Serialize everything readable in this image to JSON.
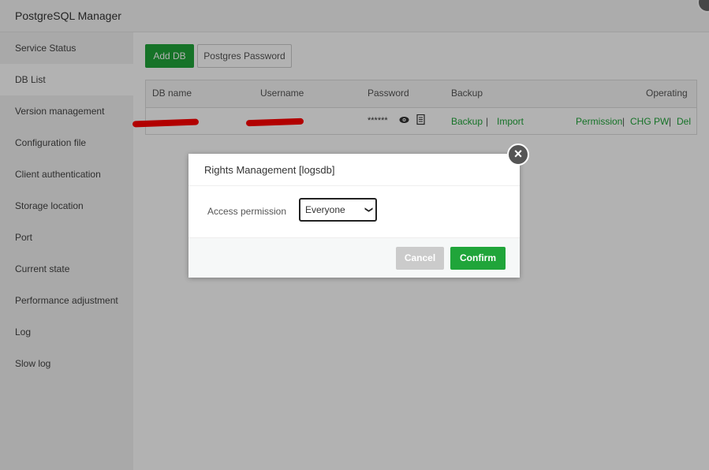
{
  "app": {
    "title": "PostgreSQL Manager"
  },
  "sidebar": {
    "items": [
      {
        "label": "Service Status"
      },
      {
        "label": "DB List"
      },
      {
        "label": "Version management"
      },
      {
        "label": "Configuration file"
      },
      {
        "label": "Client authentication"
      },
      {
        "label": "Storage location"
      },
      {
        "label": "Port"
      },
      {
        "label": "Current state"
      },
      {
        "label": "Performance adjustment"
      },
      {
        "label": "Log"
      },
      {
        "label": "Slow log"
      }
    ],
    "active_label": "DB List"
  },
  "toolbar": {
    "add_db": "Add DB",
    "postgres_password": "Postgres Password"
  },
  "table": {
    "headers": [
      "DB name",
      "Username",
      "Password",
      "Backup",
      "Operating"
    ],
    "row": {
      "password_mask": "******",
      "backup": "Backup",
      "import": "Import",
      "permission": "Permission",
      "chg_pw": "CHG PW",
      "del": "Del",
      "separator": "|"
    }
  },
  "modal": {
    "title": "Rights Management [logsdb]",
    "field_label": "Access permission",
    "select_value": "Everyone",
    "cancel": "Cancel",
    "confirm": "Confirm"
  },
  "colors": {
    "accent_green": "#20a53a",
    "redaction": "#ff0000"
  },
  "icons": {
    "eye": "eye-icon",
    "copy": "copy-icon",
    "close": "close-icon",
    "chevron": "chevron-down-icon"
  }
}
